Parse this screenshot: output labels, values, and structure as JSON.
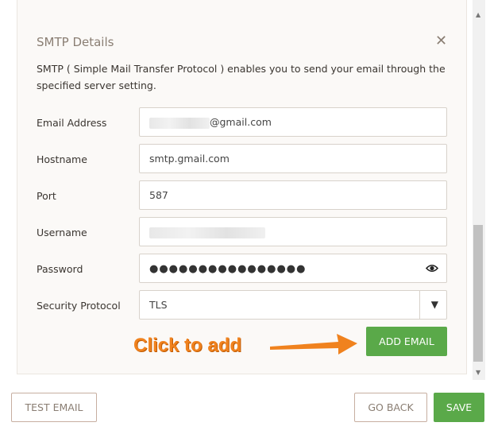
{
  "panel": {
    "title": "SMTP Details",
    "close_icon": "close-icon",
    "description": "SMTP ( Simple Mail Transfer Protocol ) enables you to send your email through the specified server setting."
  },
  "form": {
    "email_label": "Email Address",
    "email_suffix": "@gmail.com",
    "hostname_label": "Hostname",
    "hostname_value": "smtp.gmail.com",
    "port_label": "Port",
    "port_value": "587",
    "username_label": "Username",
    "password_label": "Password",
    "password_value": "●●●●●●●●●●●●●●●●",
    "password_icon": "eye-icon",
    "security_label": "Security Protocol",
    "security_value": "TLS",
    "security_arrow_icon": "triangle-down-icon"
  },
  "actions": {
    "add_email": "ADD EMAIL",
    "test_email": "TEST EMAIL",
    "go_back": "GO BACK",
    "save": "SAVE"
  },
  "annotation": {
    "text": "Click to add",
    "color": "#f0821e"
  },
  "colors": {
    "accent_green": "#5aa949",
    "muted_brown": "#8a7e73"
  }
}
